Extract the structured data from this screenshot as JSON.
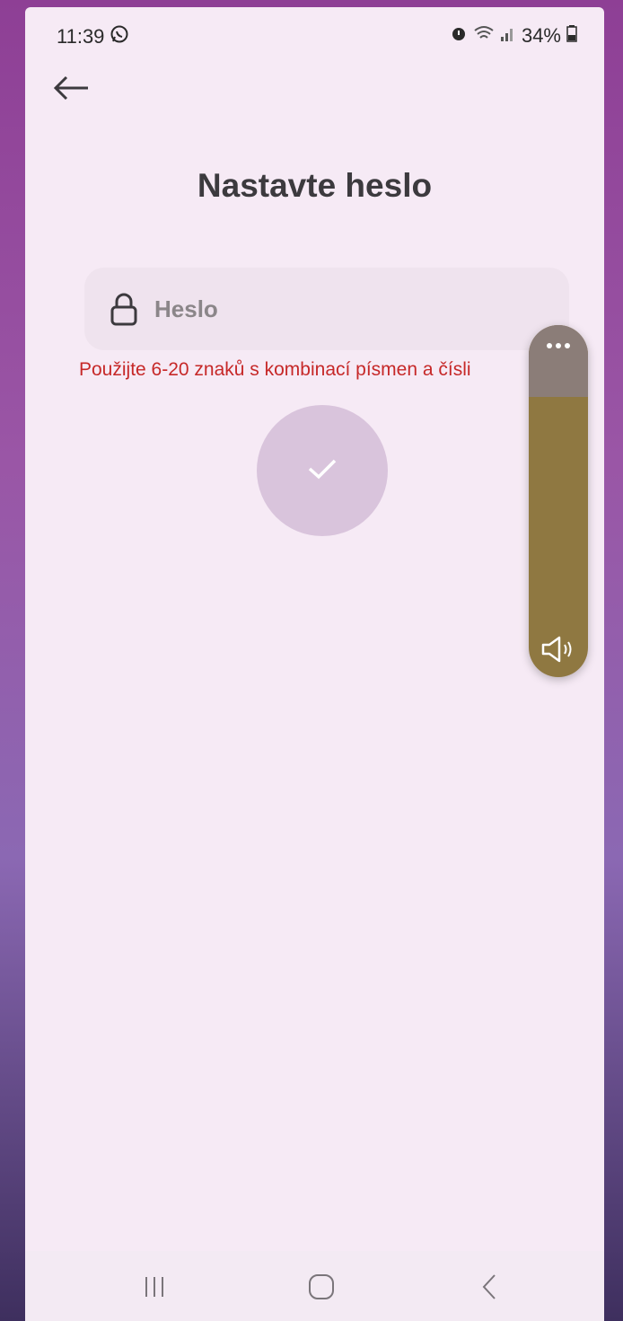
{
  "status_bar": {
    "time": "11:39",
    "battery": "34%",
    "icons": [
      "whatsapp-icon",
      "alarm-icon",
      "wifi-icon",
      "signal-icon",
      "battery-icon"
    ]
  },
  "header": {
    "back_icon": "back-arrow-icon"
  },
  "page": {
    "title": "Nastavte heslo"
  },
  "password_field": {
    "placeholder": "Heslo",
    "value": "",
    "icon": "lock-icon"
  },
  "hint": {
    "text": "Použijte 6-20 znaků s kombinací písmen a čísli",
    "color": "#c62828"
  },
  "submit": {
    "icon": "checkmark-icon",
    "color": "#d9c4dc"
  },
  "volume_overlay": {
    "more_icon": "more-dots-icon",
    "speaker_icon": "speaker-icon",
    "color": "#8f7841"
  },
  "nav_bar": {
    "items": [
      "recent-apps-icon",
      "home-icon",
      "back-icon"
    ]
  }
}
